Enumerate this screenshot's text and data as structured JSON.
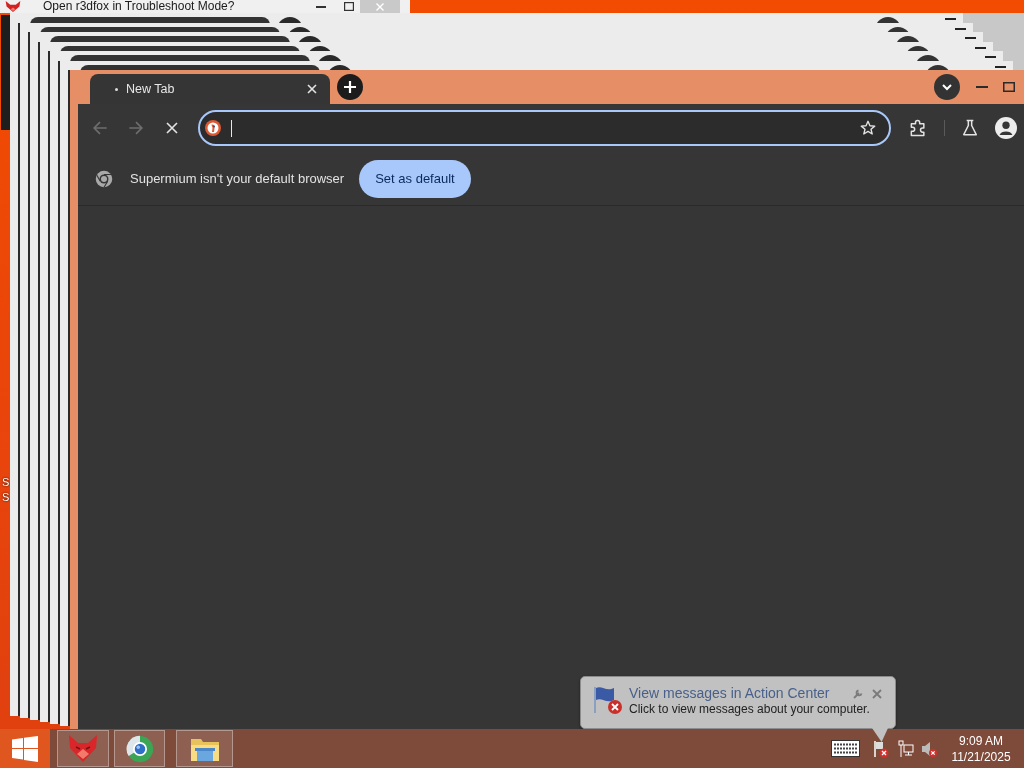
{
  "desktop": {
    "label_fragments": [
      "S",
      "S"
    ]
  },
  "dialog": {
    "title": "Open r3dfox in Troubleshoot Mode?"
  },
  "browser": {
    "tabs": [
      {
        "title": "New Tab",
        "selected": true
      }
    ],
    "nav_buttons": [
      {
        "kind": "back",
        "disabled": true
      },
      {
        "kind": "forward",
        "disabled": true
      },
      {
        "kind": "stop",
        "disabled": false
      }
    ],
    "infobar": {
      "message": "Supermium isn't your default browser",
      "button": "Set as default"
    }
  },
  "notification": {
    "title": "View messages in Action Center",
    "body": "Click to view messages about your computer."
  },
  "taskbar": {
    "apps": [
      {
        "kind": "fox"
      },
      {
        "kind": "globe"
      },
      {
        "kind": "folder"
      }
    ],
    "tray": [
      {
        "kind": "keyboard"
      },
      {
        "kind": "flag"
      },
      {
        "kind": "network"
      },
      {
        "kind": "speaker"
      }
    ],
    "clock": {
      "time": "9:09 AM",
      "date": "11/21/2025"
    }
  }
}
